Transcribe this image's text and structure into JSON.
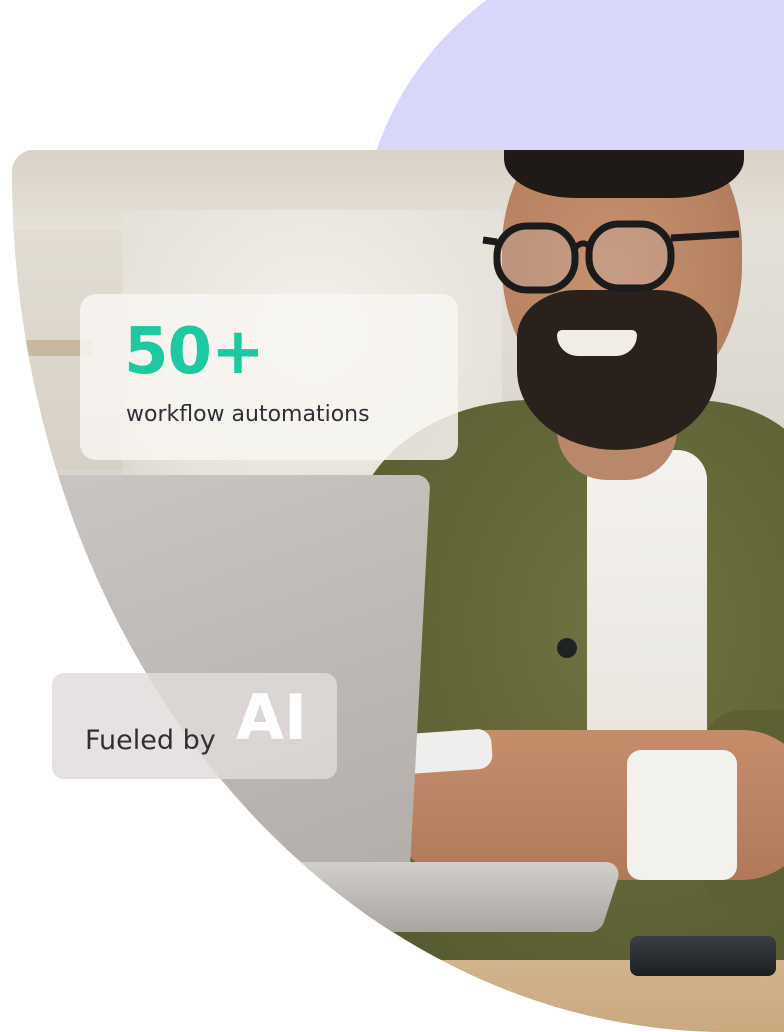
{
  "stat_card": {
    "value": "50+",
    "label": "workflow automations"
  },
  "ai_badge": {
    "prefix": "Fueled by",
    "highlight": "AI"
  },
  "colors": {
    "accent": "#1cc9a0",
    "circle": "#d9d6fb",
    "text": "#2e2f37"
  }
}
